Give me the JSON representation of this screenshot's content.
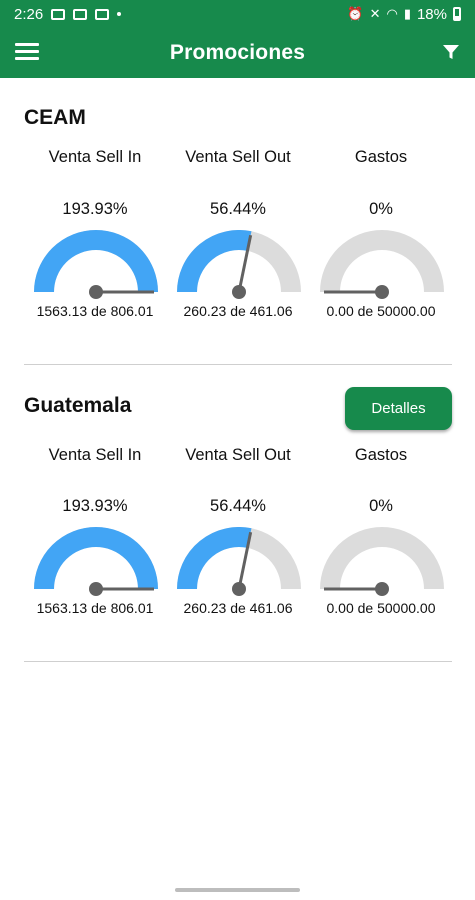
{
  "status_bar": {
    "time": "2:26",
    "battery": "18%"
  },
  "app_bar": {
    "title": "Promociones",
    "menu_icon": "menu-icon",
    "filter_icon": "filter-icon"
  },
  "colors": {
    "brand": "#178a4c",
    "gauge_fill": "#42a5f5",
    "gauge_track": "#dcdcdc",
    "needle": "#616161"
  },
  "sections": [
    {
      "name": "CEAM",
      "gauges": [
        {
          "label": "Venta Sell In",
          "percent": "193.93%",
          "detail": "1563.13 de 806.01",
          "fill_fraction": 1.0
        },
        {
          "label": "Venta Sell Out",
          "percent": "56.44%",
          "detail": "260.23 de 461.06",
          "fill_fraction": 0.5644
        },
        {
          "label": "Gastos",
          "percent": "0%",
          "detail": "0.00 de 50000.00",
          "fill_fraction": 0.0
        }
      ]
    },
    {
      "name": "Guatemala",
      "details_button": "Detalles",
      "gauges": [
        {
          "label": "Venta Sell In",
          "percent": "193.93%",
          "detail": "1563.13 de 806.01",
          "fill_fraction": 1.0
        },
        {
          "label": "Venta Sell Out",
          "percent": "56.44%",
          "detail": "260.23 de 461.06",
          "fill_fraction": 0.5644
        },
        {
          "label": "Gastos",
          "percent": "0%",
          "detail": "0.00 de 50000.00",
          "fill_fraction": 0.0
        }
      ]
    }
  ]
}
